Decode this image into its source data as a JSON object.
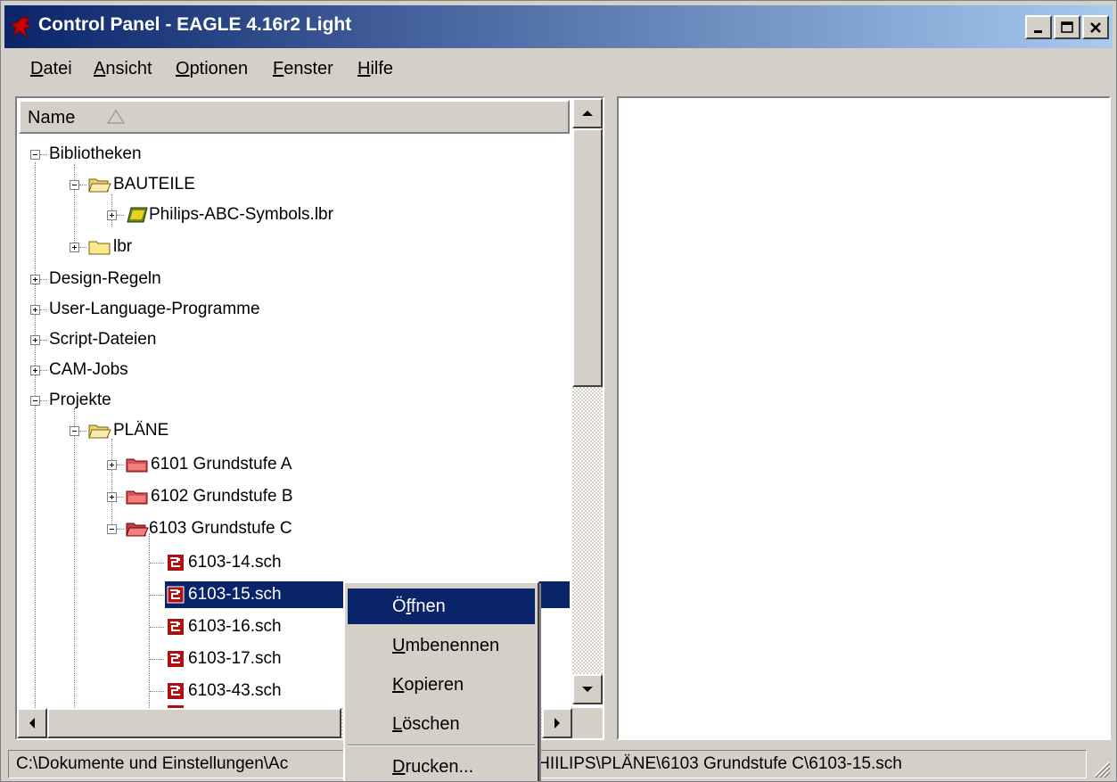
{
  "window": {
    "title": "Control Panel - EAGLE 4.16r2 Light",
    "controls": {
      "minimize": "_",
      "maximize": "□",
      "close": "×"
    }
  },
  "menu": [
    {
      "label": "Datei",
      "mnemonic": "D",
      "rest": "atei"
    },
    {
      "label": "Ansicht",
      "mnemonic": "A",
      "rest": "nsicht"
    },
    {
      "label": "Optionen",
      "mnemonic": "O",
      "rest": "ptionen"
    },
    {
      "label": "Fenster",
      "mnemonic": "F",
      "rest": "enster"
    },
    {
      "label": "Hilfe",
      "mnemonic": "H",
      "rest": "ilfe"
    }
  ],
  "tree": {
    "column_header": "Name",
    "items": [
      {
        "label": "Bibliotheken",
        "icon": "none",
        "expander": "minus"
      },
      {
        "label": "BAUTEILE",
        "icon": "folder-open-icon",
        "expander": "minus"
      },
      {
        "label": "Philips-ABC-Symbols.lbr",
        "icon": "library-book-icon",
        "expander": "plus"
      },
      {
        "label": "lbr",
        "icon": "folder-icon",
        "expander": "plus"
      },
      {
        "label": "Design-Regeln",
        "icon": "none",
        "expander": "plus"
      },
      {
        "label": "User-Language-Programme",
        "icon": "none",
        "expander": "plus"
      },
      {
        "label": "Script-Dateien",
        "icon": "none",
        "expander": "plus"
      },
      {
        "label": "CAM-Jobs",
        "icon": "none",
        "expander": "plus"
      },
      {
        "label": "Projekte",
        "icon": "none",
        "expander": "minus"
      },
      {
        "label": "PLÄNE",
        "icon": "folder-open-icon",
        "expander": "minus"
      },
      {
        "label": "6101 Grundstufe A",
        "icon": "project-folder-icon",
        "expander": "plus"
      },
      {
        "label": "6102 Grundstufe B",
        "icon": "project-folder-icon",
        "expander": "plus"
      },
      {
        "label": "6103 Grundstufe C",
        "icon": "project-folder-open-icon",
        "expander": "minus"
      },
      {
        "label": "6103-14.sch",
        "icon": "schematic-icon",
        "expander": "none"
      },
      {
        "label": "6103-15.sch",
        "icon": "schematic-icon",
        "expander": "none",
        "selected": true
      },
      {
        "label": "6103-16.sch",
        "icon": "schematic-icon",
        "expander": "none"
      },
      {
        "label": "6103-17.sch",
        "icon": "schematic-icon",
        "expander": "none"
      },
      {
        "label": "6103-43.sch",
        "icon": "schematic-icon",
        "expander": "none"
      }
    ]
  },
  "context_menu": {
    "items": [
      {
        "label": "Öffnen",
        "mnemonic": "f",
        "pre": "Ö",
        "post": "fnen",
        "active": true
      },
      {
        "label": "Umbenennen",
        "mnemonic": "U",
        "pre": "",
        "post": "mbenennen"
      },
      {
        "label": "Kopieren",
        "mnemonic": "K",
        "pre": "",
        "post": "opieren"
      },
      {
        "label": "Löschen",
        "mnemonic": "L",
        "pre": "",
        "post": "öschen"
      },
      {
        "label": "Drucken...",
        "mnemonic": "D",
        "pre": "",
        "post": "rucken..."
      }
    ]
  },
  "statusbar": {
    "path": "C:\\Dokumente und Einstellungen\\Ac",
    "path_tail": "eien\\PHIILIPS\\PLÄNE\\6103 Grundstufe C\\6103-15.sch"
  },
  "colors": {
    "title_start": "#0a246a",
    "title_end": "#a6caf0",
    "selection": "#0a246a",
    "face": "#d4d0c8"
  }
}
